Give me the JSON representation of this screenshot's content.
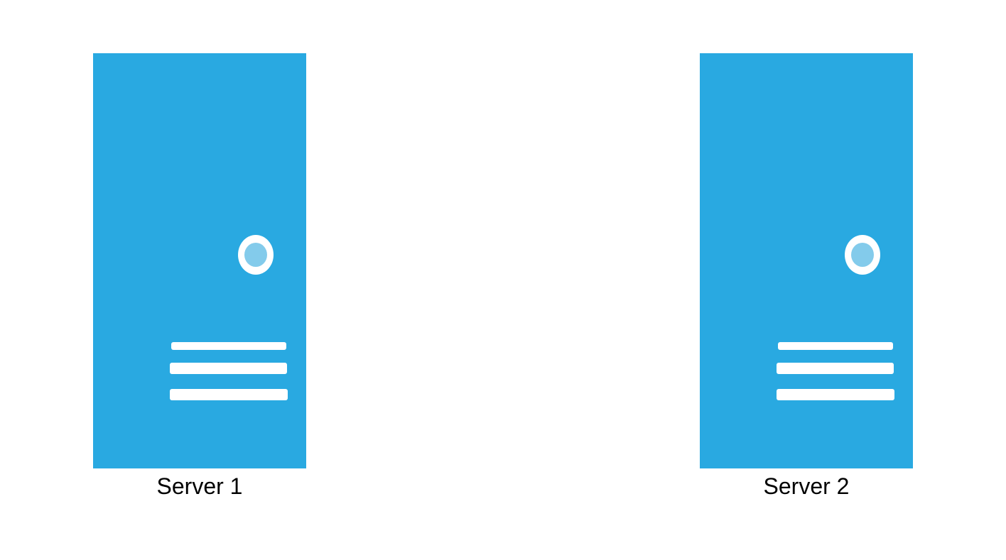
{
  "colors": {
    "server_body": "#29a9e1",
    "power_indicator": "#83cbeb",
    "vent": "#ffffff",
    "label_text": "#000000",
    "background": "#ffffff"
  },
  "servers": [
    {
      "label": "Server 1",
      "icon": "server-tower-icon"
    },
    {
      "label": "Server 2",
      "icon": "server-tower-icon"
    }
  ]
}
